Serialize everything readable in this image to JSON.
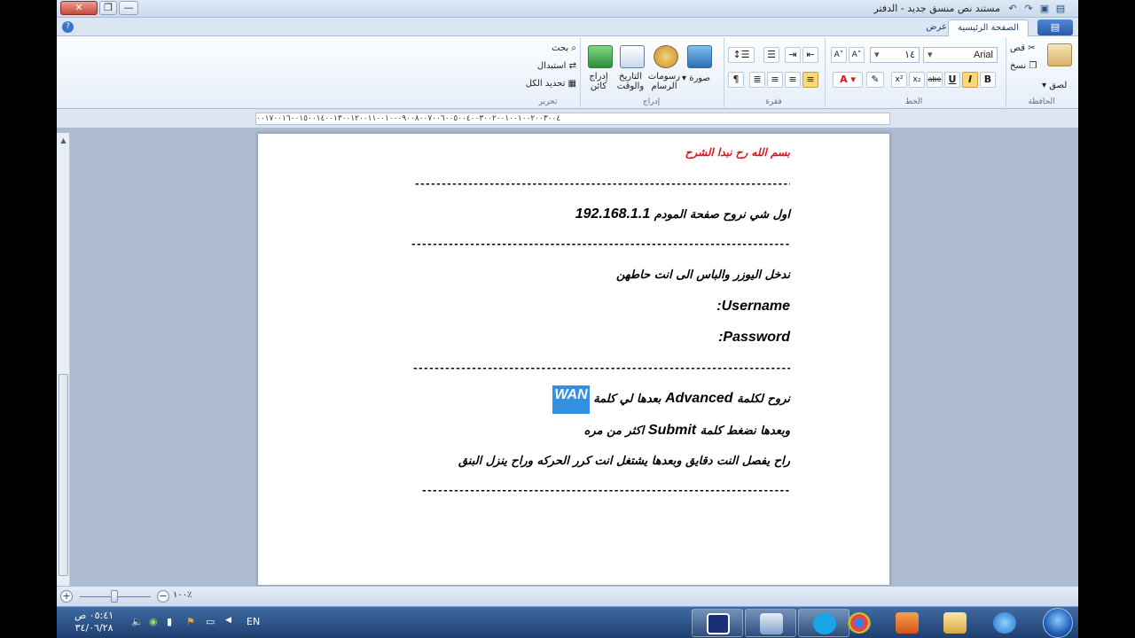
{
  "window": {
    "title": "مستند نص منسق جديد - الدفتر",
    "close_glyph": "✕",
    "max_glyph": "❐",
    "min_glyph": "—"
  },
  "ribbon": {
    "app_button_glyph": "▤",
    "tabs": [
      {
        "label": "الصفحة الرئيسية"
      },
      {
        "label": "عرض"
      }
    ],
    "clipboard": {
      "paste": "لصق",
      "cut": "قص",
      "copy": "نسخ",
      "group": "الحافظة"
    },
    "font": {
      "family": "Arial",
      "size": "١٤",
      "grow": "A˄",
      "shrink": "A˅",
      "bold": "B",
      "italic": "I",
      "underline": "U",
      "strike": "abe",
      "subscript": "x₂",
      "superscript": "x²",
      "group": "الخط"
    },
    "paragraph": {
      "group": "فقرة"
    },
    "insert": {
      "picture": "صورة",
      "paint": "رسومات الرسام",
      "datetime": "التاريخ والوقت",
      "object": "إدراج كائن",
      "group": "إدراج"
    },
    "editing": {
      "find": "بحث",
      "replace": "استبدال",
      "select_all": "تحديد الكل",
      "group": "تحرير"
    }
  },
  "ruler": {
    "text": "٠٠١٧٠٠١٦٠٠١٥٠٠١٤٠٠١٣٠٠١٢٠٠١١٠٠١٠٠٠٩٠٠٨٠٠٧٠٠٦٠٠٥٠٠٤٠٠٣٠٠٢٠٠١٠٠١٠٠٢٠٠٣٠٠٤"
  },
  "document": {
    "line1": "بسم الله رح نبدا الشرح",
    "dashes": "------------------------------------------------------------------------------------",
    "line2_ar": "اول شي نروح صفحة المودم",
    "line2_ip": "192.168.1.1",
    "line3": "ندخل اليوزر والباس الى انت حاطهن",
    "username": "Username:",
    "password": "Password:",
    "line6_a": "نروح لكلمة",
    "line6_adv": "Advanced",
    "line6_b": "بعدها لي كلمة",
    "line6_wan": "WAN",
    "line7_a": "وبعدها نضغط كلمة",
    "line7_submit": "Submit",
    "line7_b": "اكثر من مره",
    "line8": "راح يفصل النت دقايق وبعدها يشتغل انت كرر الحركه وراح ينزل البنق"
  },
  "statusbar": {
    "zoom": "١٠٠٪"
  },
  "taskbar": {
    "lang": "EN",
    "time": "٠٥:٤١ ص",
    "date": "٣٤/٠٦/٢٨"
  },
  "colors": {
    "heading_red": "#e0101a",
    "highlight": "#3390e3"
  }
}
